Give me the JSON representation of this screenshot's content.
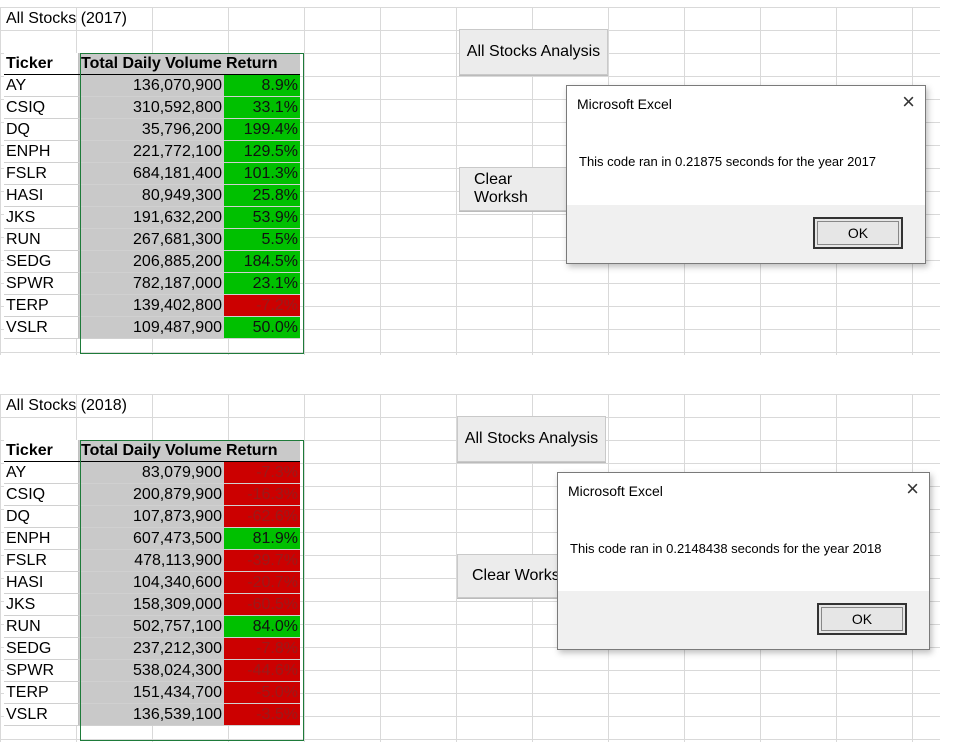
{
  "sheets": [
    {
      "title": "All Stocks (2017)",
      "headers": {
        "ticker": "Ticker",
        "volume": "Total Daily Volume",
        "return": "Return"
      },
      "rows": [
        {
          "ticker": "AY",
          "volume": "136,070,900",
          "ret": "8.9%",
          "dir": "pos"
        },
        {
          "ticker": "CSIQ",
          "volume": "310,592,800",
          "ret": "33.1%",
          "dir": "pos"
        },
        {
          "ticker": "DQ",
          "volume": "35,796,200",
          "ret": "199.4%",
          "dir": "pos"
        },
        {
          "ticker": "ENPH",
          "volume": "221,772,100",
          "ret": "129.5%",
          "dir": "pos"
        },
        {
          "ticker": "FSLR",
          "volume": "684,181,400",
          "ret": "101.3%",
          "dir": "pos"
        },
        {
          "ticker": "HASI",
          "volume": "80,949,300",
          "ret": "25.8%",
          "dir": "pos"
        },
        {
          "ticker": "JKS",
          "volume": "191,632,200",
          "ret": "53.9%",
          "dir": "pos"
        },
        {
          "ticker": "RUN",
          "volume": "267,681,300",
          "ret": "5.5%",
          "dir": "pos"
        },
        {
          "ticker": "SEDG",
          "volume": "206,885,200",
          "ret": "184.5%",
          "dir": "pos"
        },
        {
          "ticker": "SPWR",
          "volume": "782,187,000",
          "ret": "23.1%",
          "dir": "pos"
        },
        {
          "ticker": "TERP",
          "volume": "139,402,800",
          "ret": "-7.2%",
          "dir": "neg"
        },
        {
          "ticker": "VSLR",
          "volume": "109,487,900",
          "ret": "50.0%",
          "dir": "pos"
        }
      ],
      "buttons": {
        "analysis": "All Stocks Analysis",
        "clear": "Clear Worksh"
      },
      "dialog": {
        "title": "Microsoft Excel",
        "message": "This code ran in 0.21875 seconds for the year 2017",
        "ok": "OK",
        "close": "×"
      }
    },
    {
      "title": "All Stocks (2018)",
      "headers": {
        "ticker": "Ticker",
        "volume": "Total Daily Volume",
        "return": "Return"
      },
      "rows": [
        {
          "ticker": "AY",
          "volume": "83,079,900",
          "ret": "-7.3%",
          "dir": "neg"
        },
        {
          "ticker": "CSIQ",
          "volume": "200,879,900",
          "ret": "-16.3%",
          "dir": "neg"
        },
        {
          "ticker": "DQ",
          "volume": "107,873,900",
          "ret": "-62.6%",
          "dir": "neg"
        },
        {
          "ticker": "ENPH",
          "volume": "607,473,500",
          "ret": "81.9%",
          "dir": "pos"
        },
        {
          "ticker": "FSLR",
          "volume": "478,113,900",
          "ret": "-39.7%",
          "dir": "neg"
        },
        {
          "ticker": "HASI",
          "volume": "104,340,600",
          "ret": "-20.7%",
          "dir": "neg"
        },
        {
          "ticker": "JKS",
          "volume": "158,309,000",
          "ret": "-60.5%",
          "dir": "neg"
        },
        {
          "ticker": "RUN",
          "volume": "502,757,100",
          "ret": "84.0%",
          "dir": "pos"
        },
        {
          "ticker": "SEDG",
          "volume": "237,212,300",
          "ret": "-7.8%",
          "dir": "neg"
        },
        {
          "ticker": "SPWR",
          "volume": "538,024,300",
          "ret": "-44.6%",
          "dir": "neg"
        },
        {
          "ticker": "TERP",
          "volume": "151,434,700",
          "ret": "-5.0%",
          "dir": "neg"
        },
        {
          "ticker": "VSLR",
          "volume": "136,539,100",
          "ret": "-3.5%",
          "dir": "neg"
        }
      ],
      "buttons": {
        "analysis": "All Stocks Analysis",
        "clear": "Clear Works"
      },
      "dialog": {
        "title": "Microsoft Excel",
        "message": "This code ran in 0.2148438 seconds for the year 2018",
        "ok": "OK",
        "close": "×"
      }
    }
  ],
  "colors": {
    "positive": "#00c000",
    "negative": "#cc0000",
    "volume_fill": "#c9c9c9"
  }
}
